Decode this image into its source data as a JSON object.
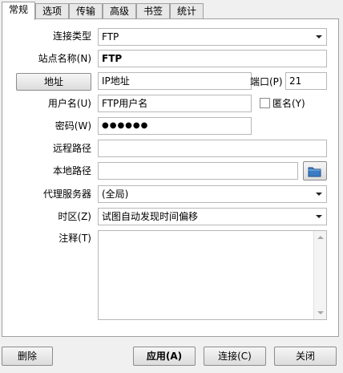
{
  "tabs": [
    "常规",
    "选项",
    "传输",
    "高级",
    "书签",
    "统计"
  ],
  "form": {
    "conn_type_label": "连接类型",
    "conn_type_value": "FTP",
    "site_name_label": "站点名称(N)",
    "site_name_value": "FTP",
    "address_button": "地址",
    "address_value": "IP地址",
    "port_label": "端口(P)",
    "port_value": "21",
    "username_label": "用户名(U)",
    "username_value": "FTP用户名",
    "anonymous_label": "匿名(Y)",
    "password_label": "密码(W)",
    "password_value": "●●●●●●",
    "remote_path_label": "远程路径",
    "remote_path_value": "",
    "local_path_label": "本地路径",
    "local_path_value": "",
    "proxy_label": "代理服务器",
    "proxy_value": "(全局)",
    "timezone_label": "时区(Z)",
    "timezone_value": "试图自动发现时间偏移",
    "comment_label": "注释(T)",
    "comment_value": ""
  },
  "buttons": {
    "delete": "删除",
    "apply": "应用(A)",
    "connect": "连接(C)",
    "close": "关闭"
  }
}
